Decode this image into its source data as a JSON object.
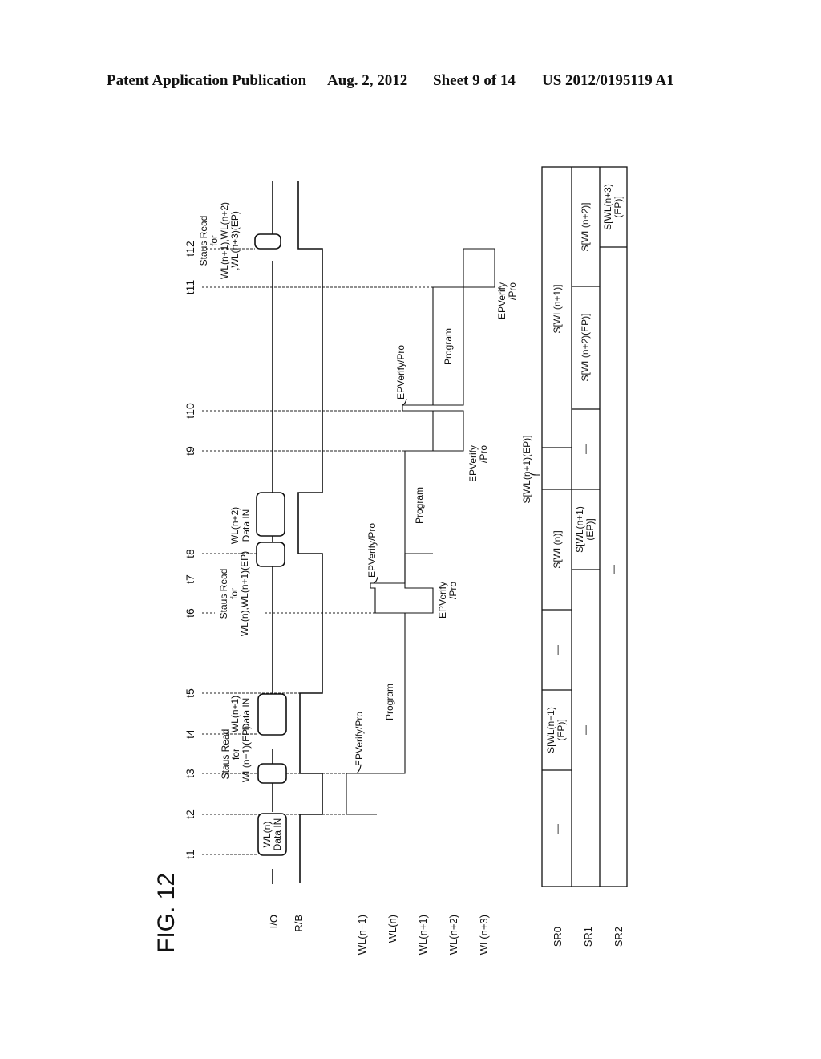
{
  "header": {
    "publication": "Patent Application Publication",
    "date": "Aug. 2, 2012",
    "sheet": "Sheet 9 of 14",
    "number": "US 2012/0195119 A1"
  },
  "figure": {
    "title": "FIG. 12",
    "signals": [
      "I/O",
      "R/B",
      "WL(n−1)",
      "WL(n)",
      "WL(n+1)",
      "WL(n+2)",
      "WL(n+3)"
    ],
    "times": [
      "t1",
      "t2",
      "t3",
      "t4",
      "t5",
      "t6",
      "t7",
      "t8",
      "t9",
      "t10",
      "t11",
      "t12"
    ],
    "io_annotations": {
      "data_in_n": [
        "WL(n)",
        "Data IN"
      ],
      "status_read_1": [
        "Staus Read",
        "for",
        "WL(n−1)(EP)"
      ],
      "data_in_n1": [
        "WL(n+1)",
        "Data IN"
      ],
      "status_read_2": [
        "Staus Read",
        "for",
        "WL(n),WL(n+1)(EP)"
      ],
      "data_in_n2": [
        "WL(n+2)",
        "Data IN"
      ],
      "status_read_3": [
        "Staus Read",
        "for",
        "WL(n+1),WL(n+2)",
        ",WL(n+3)(EP)"
      ]
    },
    "wl_annotations": {
      "epverify_pro": "EPVerify/Pro",
      "epverify_split": [
        "EPVerify",
        "/Pro"
      ],
      "program": "Program"
    },
    "status_registers": {
      "labels": [
        "SR0",
        "SR1",
        "SR2"
      ],
      "sr0": [
        "—",
        "S[WL(n−1)(EP)]",
        "—",
        "S[WL(n)]",
        "",
        "S[WL(n+1)]"
      ],
      "sr1": [
        "—",
        "S[WL(n+1)(EP)]",
        "—",
        "S[WL(n+2)(EP)]",
        "S[WL(n+2)]"
      ],
      "sr2": [
        "—",
        "S[WL(n+3)(EP)]"
      ],
      "callout": "S[WL(n+1)(EP)]"
    }
  }
}
